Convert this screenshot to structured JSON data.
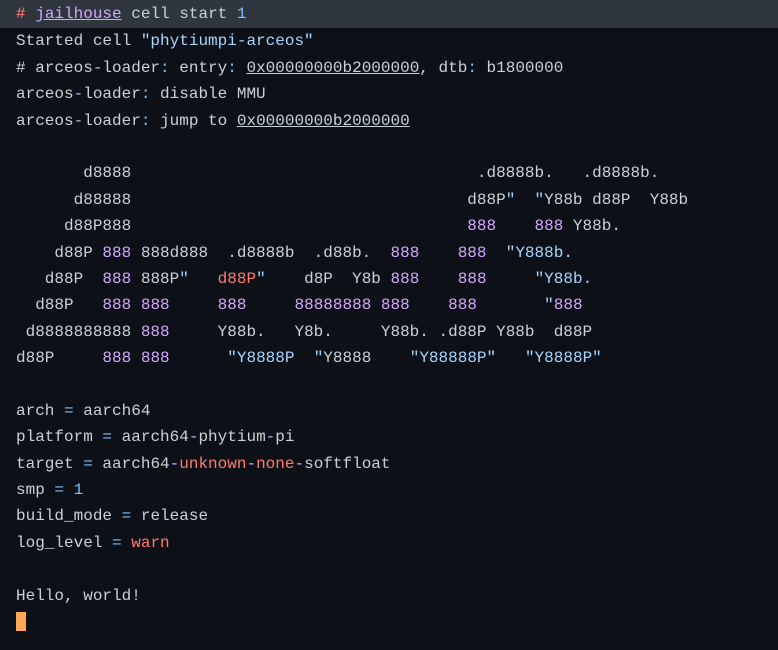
{
  "prompt": {
    "hash": "#",
    "cmd": "jailhouse",
    "args": "cell start",
    "number": "1"
  },
  "lines": {
    "started": "Started cell ",
    "started_str": "\"phytiumpi-arceos\"",
    "l1_a": "# arceos",
    "l1_b": "loader",
    "l1_c": " entry",
    "l1_addr": "0x00000000b2000000",
    "l1_d": ", dtb",
    "l1_e": " b1800000",
    "l2_a": "arceos",
    "l2_b": "loader",
    "l2_c": " disable MMU",
    "l3_a": "arceos",
    "l3_b": "loader",
    "l3_c": " jump to ",
    "l3_addr": "0x00000000b2000000"
  },
  "ascii": {
    "r1_a": "       d8888                                    .d8888b.   .d8888b.",
    "r2_a": "      d88888                                   d88P",
    "r2_q1": "\"",
    "r2_sp": "  ",
    "r2_q2": "\"",
    "r2_b": "Y88b d88P  Y88b",
    "r3_a": "     d88P888                                   ",
    "r3_n1": "888",
    "r3_sp": "    ",
    "r3_n2": "888",
    "r3_b": " Y88b.",
    "r4_a": "    d88P ",
    "r4_n1": "888",
    "r4_b": " 888d888  .d8888b  .d88b.  ",
    "r4_n2": "888",
    "r4_sp": "    ",
    "r4_n3": "888",
    "r4_c": "  ",
    "r4_q": "\"Y888b.",
    "r5_a": "   d88P  ",
    "r5_n1": "888",
    "r5_b": " 888P",
    "r5_q1": "\"",
    "r5_sp1": "   ",
    "r5_d88p": "d88P",
    "r5_q2": "\"",
    "r5_sp2": "    d8P  Y8b ",
    "r5_n2": "888",
    "r5_sp3": "    ",
    "r5_n3": "888",
    "r5_sp4": "     ",
    "r5_q3": "\"Y88b.",
    "r6_a": "  d88P   ",
    "r6_n1": "888",
    "r6_sp1": " ",
    "r6_n2": "888",
    "r6_sp2": "     ",
    "r6_n3": "888",
    "r6_sp3": "     ",
    "r6_n4": "88888888",
    "r6_sp4": " ",
    "r6_n5": "888",
    "r6_sp5": "    ",
    "r6_n6": "888",
    "r6_sp6": "       ",
    "r6_q": "\"",
    "r6_n7": "888",
    "r7_a": " d8888888888 ",
    "r7_n1": "888",
    "r7_b": "     Y88b.   Y8b.     Y88b. .d88P Y88b  d88P",
    "r8_a": "d88P     ",
    "r8_n1": "888",
    "r8_sp1": " ",
    "r8_n2": "888",
    "r8_sp2": "      ",
    "r8_q1": "\"Y8888P",
    "r8_sp3": "  ",
    "r8_q2": "\"",
    "r8_b": "Y8888  ",
    "r8_q3": "  \"Y88888P\"",
    "r8_sp4": "   ",
    "r8_q4": "\"Y8888P\""
  },
  "info": {
    "arch_k": "arch ",
    "arch_v": " aarch64",
    "plat_k": "platform ",
    "plat_v1": " aarch64",
    "plat_v2": "phytium",
    "plat_v3": "pi",
    "tgt_k": "target ",
    "tgt_v1": " aarch64",
    "tgt_v2": "unknown",
    "tgt_v3": "none",
    "tgt_v4": "softfloat",
    "smp_k": "smp ",
    "smp_v": "1",
    "bm_k": "build_mode ",
    "bm_v": " release",
    "ll_k": "log_level ",
    "ll_v": "warn"
  },
  "hello": "Hello, world!",
  "eq": "=",
  "dash": "-",
  "colon": ":",
  "space": " "
}
